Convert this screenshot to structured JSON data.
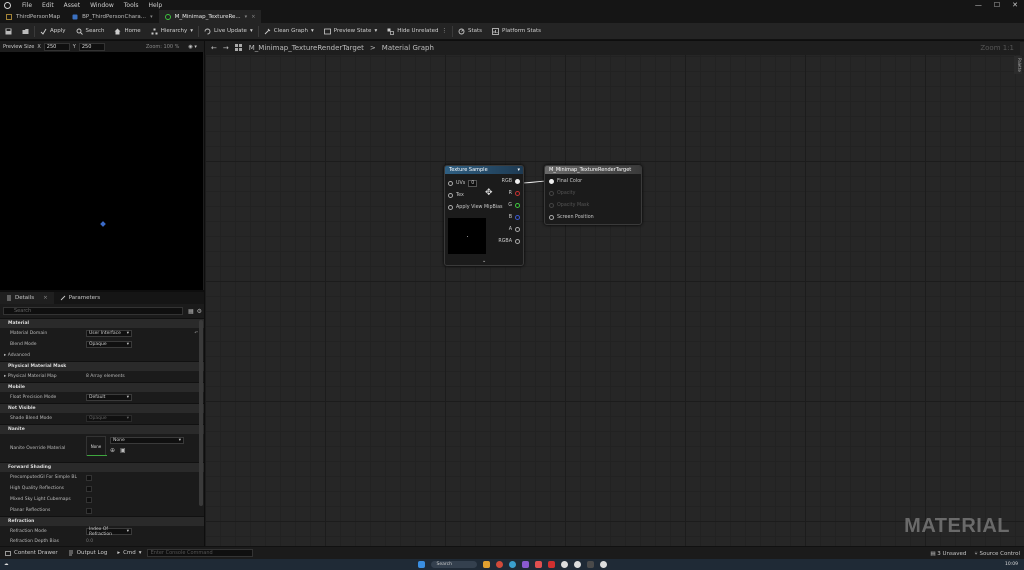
{
  "menubar": {
    "items": [
      "File",
      "Edit",
      "Asset",
      "Window",
      "Tools",
      "Help"
    ]
  },
  "tabs": [
    {
      "label": "ThirdPersonMap"
    },
    {
      "label": "BP_ThirdPersonChara..."
    },
    {
      "label": "M_Minimap_TextureRe..."
    }
  ],
  "toolbar": {
    "apply": "Apply",
    "search": "Search",
    "home": "Home",
    "hierarchy": "Hierarchy",
    "live_update": "Live Update",
    "clean_graph": "Clean Graph",
    "preview_state": "Preview State",
    "hide_unrelated": "Hide Unrelated",
    "stats": "Stats",
    "platform_stats": "Platform Stats"
  },
  "preview": {
    "size_label": "Preview Size",
    "x_label": "X",
    "x_value": "250",
    "y_label": "Y",
    "y_value": "250",
    "zoom": "Zoom: 100 %"
  },
  "details": {
    "tab_details": "Details",
    "tab_parameters": "Parameters",
    "search_placeholder": "Search",
    "cat_material": "Material",
    "material_domain_label": "Material Domain",
    "material_domain_value": "User Interface",
    "blend_mode_label": "Blend Mode",
    "blend_mode_value": "Opaque",
    "advanced": "Advanced",
    "cat_physical": "Physical Material Mask",
    "phys_map_label": "Physical Material Map",
    "phys_map_value": "8 Array elements",
    "cat_mobile": "Mobile",
    "float_label": "Float Precision Mode",
    "float_value": "Default",
    "cat_nonvisible": "Not Visible",
    "shade_label": "Shade Blend Mode",
    "shade_value": "Opaque",
    "cat_nanite": "Nanite",
    "nanite_label": "Nanite Override Material",
    "nanite_thumb": "None",
    "nanite_value": "None",
    "cat_forward": "Forward Shading",
    "fwd1": "Forward Shading",
    "fwd_a": "PrecomputedGI For Simple BL",
    "fwd_b": "High Quality Reflections",
    "fwd_c": "Mixed Sky Light Cubemaps",
    "fwd_d": "Planar Reflections",
    "cat_refraction": "Refraction",
    "refr_mode_label": "Refraction Mode",
    "refr_mode_value": "Index Of Refraction",
    "refr_depth_label": "Refraction Depth Bias",
    "refr_depth_value": "0.0"
  },
  "graph": {
    "crumb_asset": "M_Minimap_TextureRenderTarget",
    "crumb_sep": ">",
    "crumb_graph": "Material Graph",
    "zoom": "Zoom 1:1",
    "palette": "Palette",
    "watermark": "MATERIAL"
  },
  "node_tex": {
    "title": "Texture Sample",
    "uvs": "UVs",
    "uvs_val": "0",
    "tex": "Tex",
    "mip": "Apply View MipBias",
    "out_rgb": "RGB",
    "out_r": "R",
    "out_g": "G",
    "out_b": "B",
    "out_a": "A",
    "out_rgba": "RGBA"
  },
  "node_out": {
    "title": "M_Minimap_TextureRenderTarget",
    "final_color": "Final Color",
    "opacity": "Opacity",
    "opacity_mask": "Opacity Mask",
    "screen_pos": "Screen Position"
  },
  "bottombar": {
    "content_drawer": "Content Drawer",
    "output_log": "Output Log",
    "cmd": "Cmd",
    "cmd_placeholder": "Enter Console Command",
    "unsaved": "3 Unsaved",
    "source_control": "Source Control"
  },
  "taskbar": {
    "search": "Search",
    "clock": "10:09"
  },
  "colors": {
    "accent_green": "#3ea63e",
    "node_header_blue": "#2f5f82",
    "pin_r": "#c83232",
    "pin_g": "#3ec83e",
    "pin_b": "#3a5ad0"
  }
}
